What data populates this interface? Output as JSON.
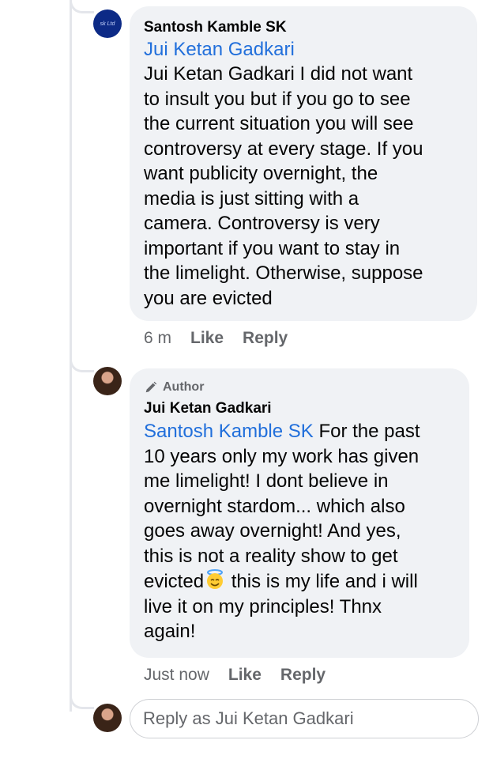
{
  "comment1": {
    "author": "Santosh Kamble SK",
    "mention": "Jui Ketan Gadkari",
    "lines": [
      "Jui Ketan Gadkari I did not want",
      "to insult you but if you go to see",
      "the current situation you will see",
      "controversy at every stage. If you",
      "want publicity overnight, the",
      "media is just sitting with a",
      "camera. Controversy is very",
      "important if you want to stay in",
      "the limelight. Otherwise, suppose",
      "you are evicted"
    ],
    "time": "6 m",
    "like_label": "Like",
    "reply_label": "Reply"
  },
  "comment2": {
    "badge": "Author",
    "author": "Jui Ketan Gadkari",
    "mention": "Santosh Kamble SK",
    "line1_rest": " For the past",
    "lines": [
      "10 years only my work has given",
      "me limelight! I dont believe in",
      "overnight stardom... which also",
      "goes away overnight! And yes,",
      "this is not a reality show to get"
    ],
    "evicted_word": "evicted",
    "after_emoji": " this is my life and i will",
    "lines_end": [
      "live it on my principles! Thnx",
      "again!"
    ],
    "time": "Just now",
    "like_label": "Like",
    "reply_label": "Reply"
  },
  "reply_box": {
    "placeholder": "Reply as Jui Ketan Gadkari"
  }
}
